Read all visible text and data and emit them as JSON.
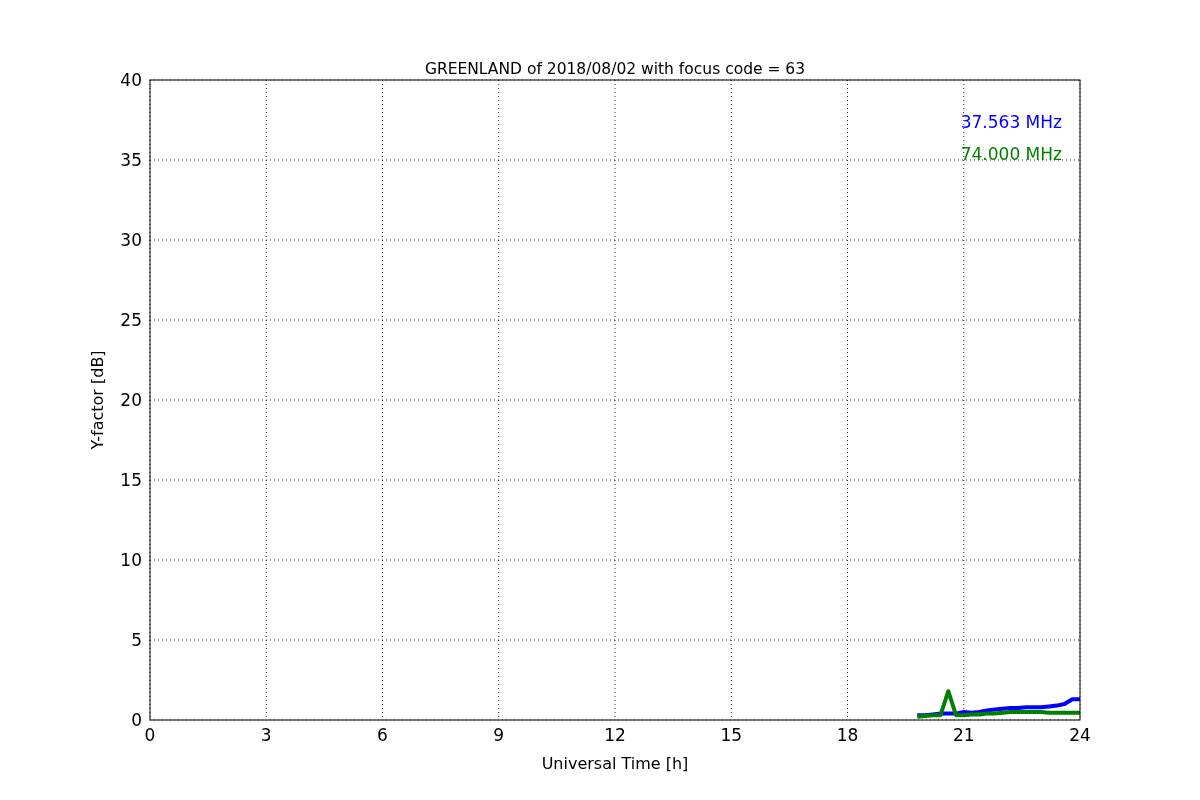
{
  "chart_data": {
    "type": "line",
    "title": "GREENLAND of 2018/08/02 with focus code = 63",
    "xlabel": "Universal Time [h]",
    "ylabel": "Y-factor [dB]",
    "x": [
      19.8,
      20.0,
      20.2,
      20.4,
      20.6,
      20.8,
      21.0,
      21.2,
      21.4,
      21.6,
      21.8,
      22.0,
      22.2,
      22.4,
      22.6,
      22.8,
      23.0,
      23.2,
      23.4,
      23.6,
      23.8,
      24.0
    ],
    "series": [
      {
        "name": "37.563 MHz",
        "color": "#0000ff",
        "values": [
          0.3,
          0.3,
          0.35,
          0.4,
          0.4,
          0.4,
          0.5,
          0.45,
          0.5,
          0.6,
          0.65,
          0.7,
          0.75,
          0.75,
          0.8,
          0.8,
          0.8,
          0.85,
          0.9,
          1.0,
          1.3,
          1.3
        ]
      },
      {
        "name": "74.000 MHz",
        "color": "#008000",
        "values": [
          0.2,
          0.25,
          0.3,
          0.3,
          1.8,
          0.3,
          0.3,
          0.35,
          0.35,
          0.4,
          0.4,
          0.45,
          0.5,
          0.5,
          0.5,
          0.5,
          0.5,
          0.45,
          0.45,
          0.45,
          0.45,
          0.45
        ]
      }
    ],
    "grid": true,
    "xlim": [
      0,
      24
    ],
    "ylim": [
      0,
      40
    ],
    "xticks": [
      0,
      3,
      6,
      9,
      12,
      15,
      18,
      21,
      24
    ],
    "yticks": [
      0,
      5,
      10,
      15,
      20,
      25,
      30,
      35,
      40
    ]
  }
}
